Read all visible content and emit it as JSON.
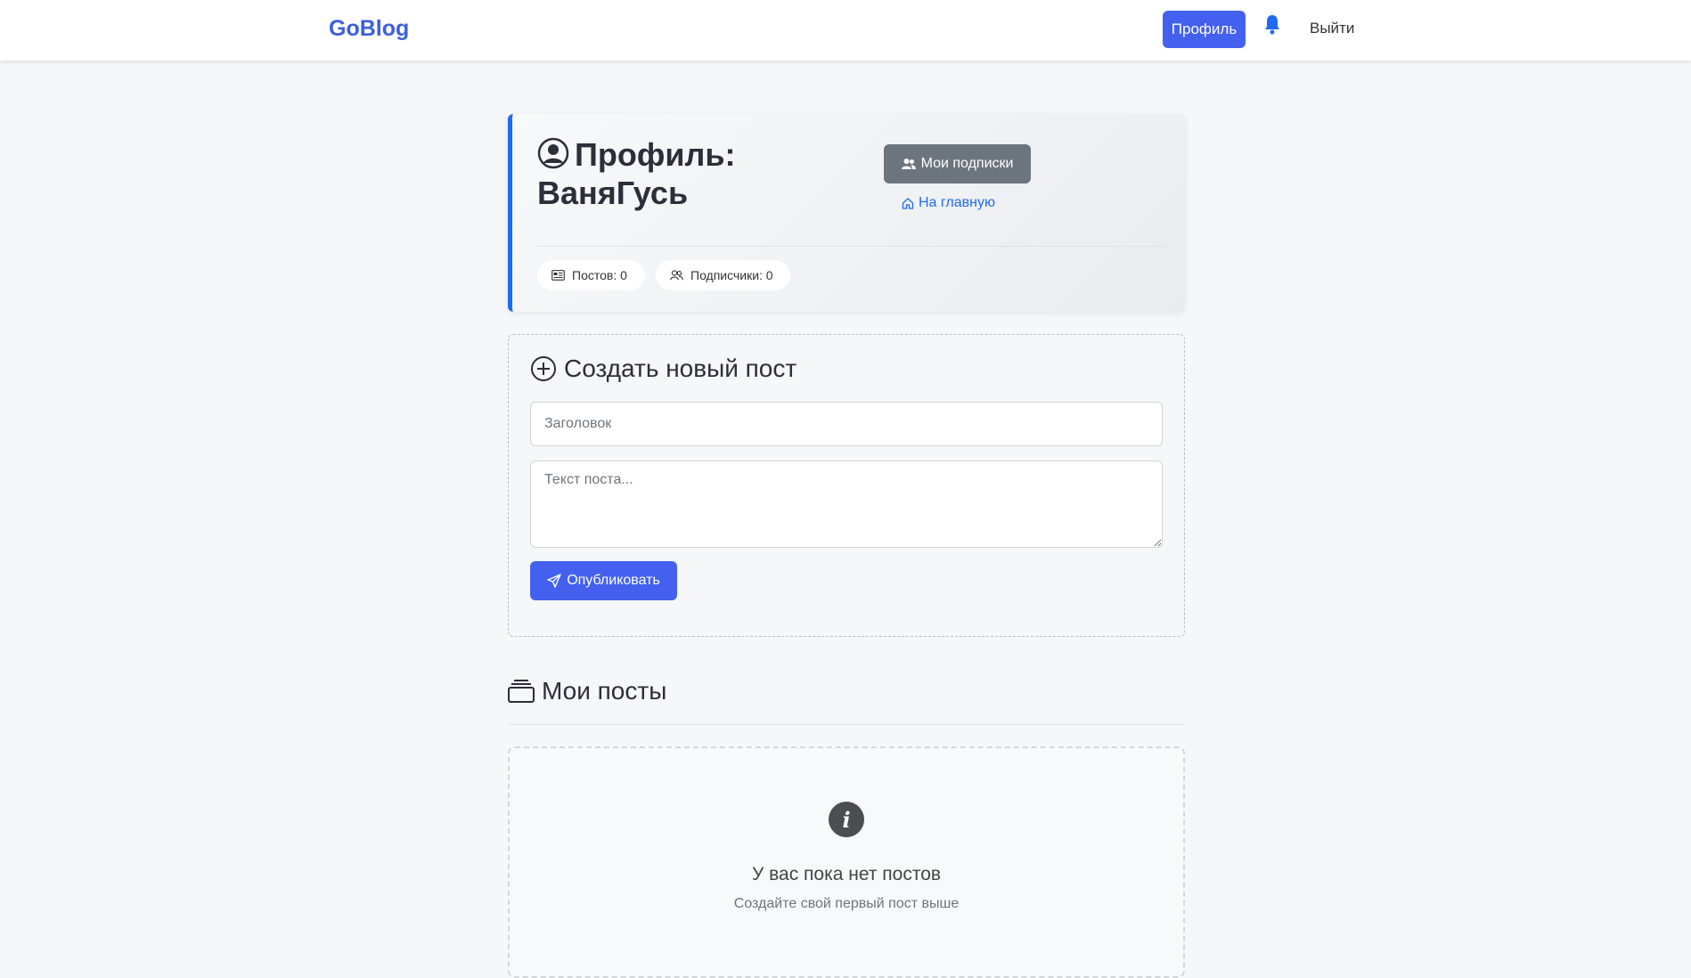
{
  "header": {
    "brand": "GoBlog",
    "profile_label": "Профиль",
    "logout_label": "Выйти"
  },
  "profile": {
    "title_prefix": "Профиль:",
    "username": "ВаняГусь",
    "subscriptions_label": "Мои подписки",
    "home_label": "На главную",
    "posts_stat": "Постов: 0",
    "subscribers_stat": "Подписчики: 0"
  },
  "create_post": {
    "title": "Создать новый пост",
    "title_placeholder": "Заголовок",
    "text_placeholder": "Текст поста...",
    "publish_label": "Опубликовать"
  },
  "my_posts": {
    "title": "Мои посты",
    "empty_title": "У вас пока нет постов",
    "empty_subtitle": "Создайте свой первый пост выше"
  },
  "colors": {
    "accent": "#4361ee",
    "link": "#1e6bf0",
    "secondary_button": "#6c757d"
  }
}
